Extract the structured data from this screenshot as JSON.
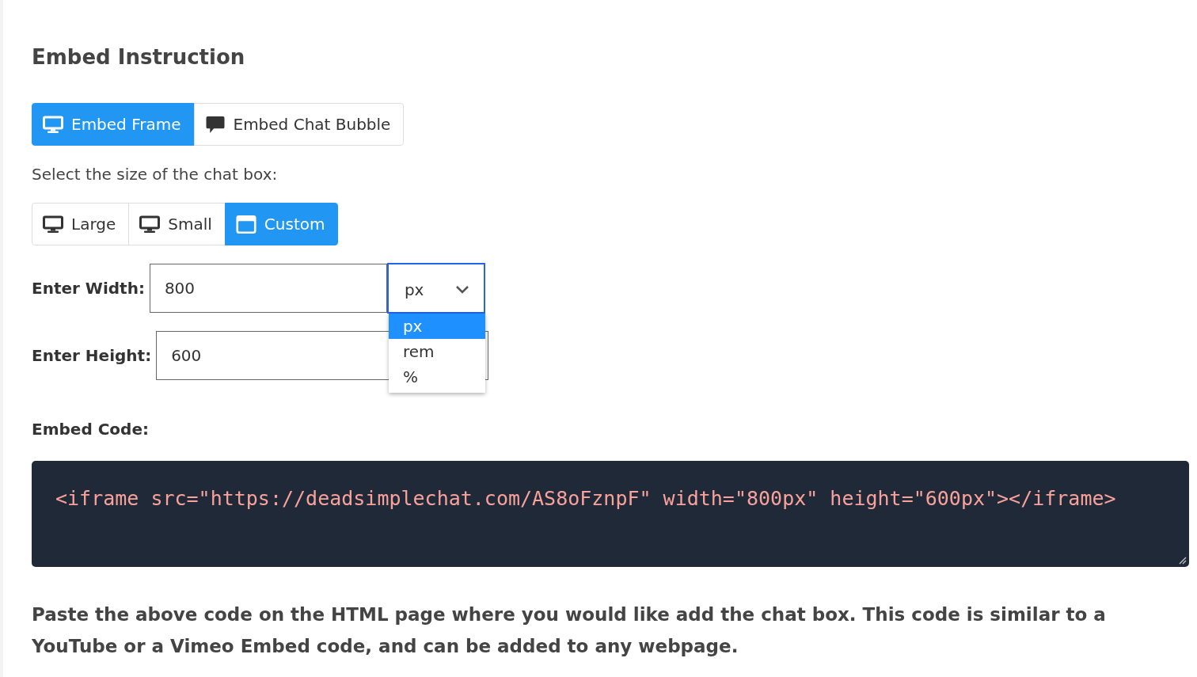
{
  "heading": "Embed Instruction",
  "embed_tabs": [
    {
      "label": "Embed Frame",
      "kind": "monitor",
      "selected": true
    },
    {
      "label": "Embed Chat Bubble",
      "kind": "chat",
      "selected": false
    }
  ],
  "size_prompt": "Select the size of the chat box:",
  "size_options": [
    {
      "label": "Large",
      "kind": "monitor",
      "selected": false
    },
    {
      "label": "Small",
      "kind": "monitor",
      "selected": false
    },
    {
      "label": "Custom",
      "kind": "window",
      "selected": true
    }
  ],
  "width_field": {
    "label": "Enter Width:",
    "value": "800",
    "unit": "px",
    "expanded": true,
    "options": [
      {
        "label": "px",
        "selected": true
      },
      {
        "label": "rem",
        "selected": false
      },
      {
        "label": "%",
        "selected": false
      }
    ]
  },
  "height_field": {
    "label": "Enter Height:",
    "value": "600"
  },
  "code_label": "Embed Code:",
  "code": "<iframe src=\"https://deadsimplechat.com/AS8oFznpF\" width=\"800px\" height=\"600px\"></iframe>",
  "note": "Paste the above code on the HTML page where you would like add the chat box. This code is similar to a YouTube or a Vimeo Embed code, and can be added to any webpage."
}
